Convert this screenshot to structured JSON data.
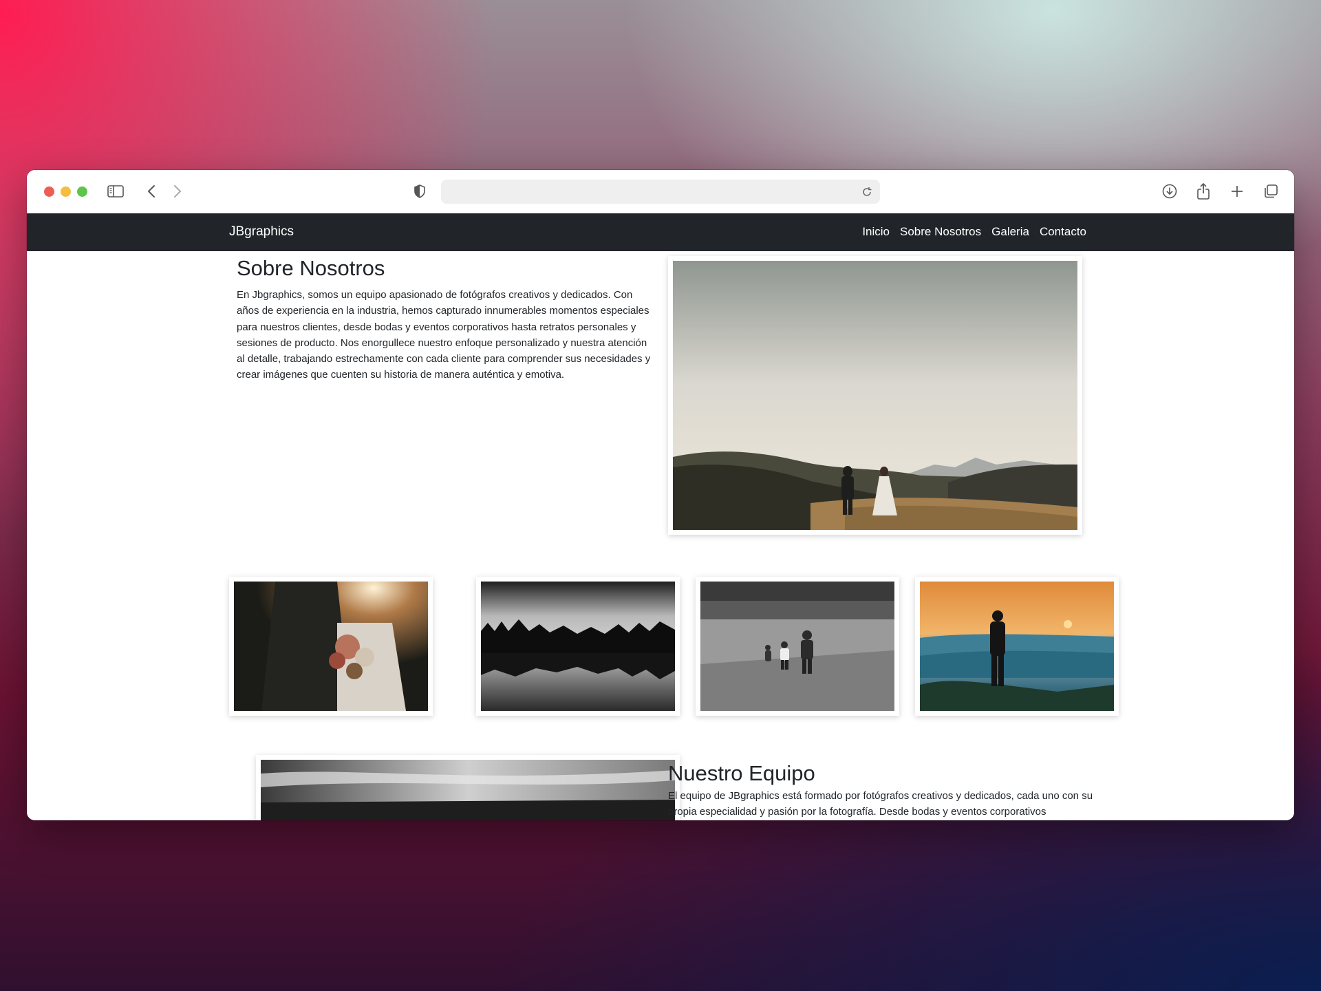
{
  "browser": {
    "url": "",
    "icons": [
      "sidebar-icon",
      "back-icon",
      "forward-icon",
      "privacy-shield-icon",
      "reload-icon",
      "download-icon",
      "share-icon",
      "new-tab-icon",
      "tabs-overview-icon"
    ]
  },
  "navbar": {
    "brand": "JBgraphics",
    "links": [
      "Inicio",
      "Sobre Nosotros",
      "Galeria",
      "Contacto"
    ]
  },
  "about": {
    "title": "Sobre Nosotros",
    "text": "En Jbgraphics, somos un equipo apasionado de fotógrafos creativos y dedicados. Con años de experiencia en la industria, hemos capturado innumerables momentos especiales para nuestros clientes, desde bodas y eventos corporativos hasta retratos personales y sesiones de producto. Nos enorgullece nuestro enfoque personalizado y nuestra atención al detalle, trabajando estrechamente con cada cliente para comprender sus necesidades y crear imágenes que cuenten su historia de manera auténtica y emotiva."
  },
  "gallery": {
    "images": [
      "wedding-couple-landscape-photo",
      "bride-bouquet-photo",
      "lake-forest-reflection-photo",
      "children-field-photo",
      "photographer-sunset-photo",
      "sky-landscape-photo"
    ]
  },
  "team": {
    "title": "Nuestro Equipo",
    "text": "El equipo de JBgraphics está formado por fotógrafos creativos y dedicados, cada uno con su propia especialidad y pasión por la fotografía. Desde bodas y eventos corporativos"
  },
  "colors": {
    "navbar_bg": "#212529",
    "text": "#212529",
    "traffic_red": "#ee5d54",
    "traffic_yellow": "#f4bd3e",
    "traffic_green": "#5ec54c"
  }
}
